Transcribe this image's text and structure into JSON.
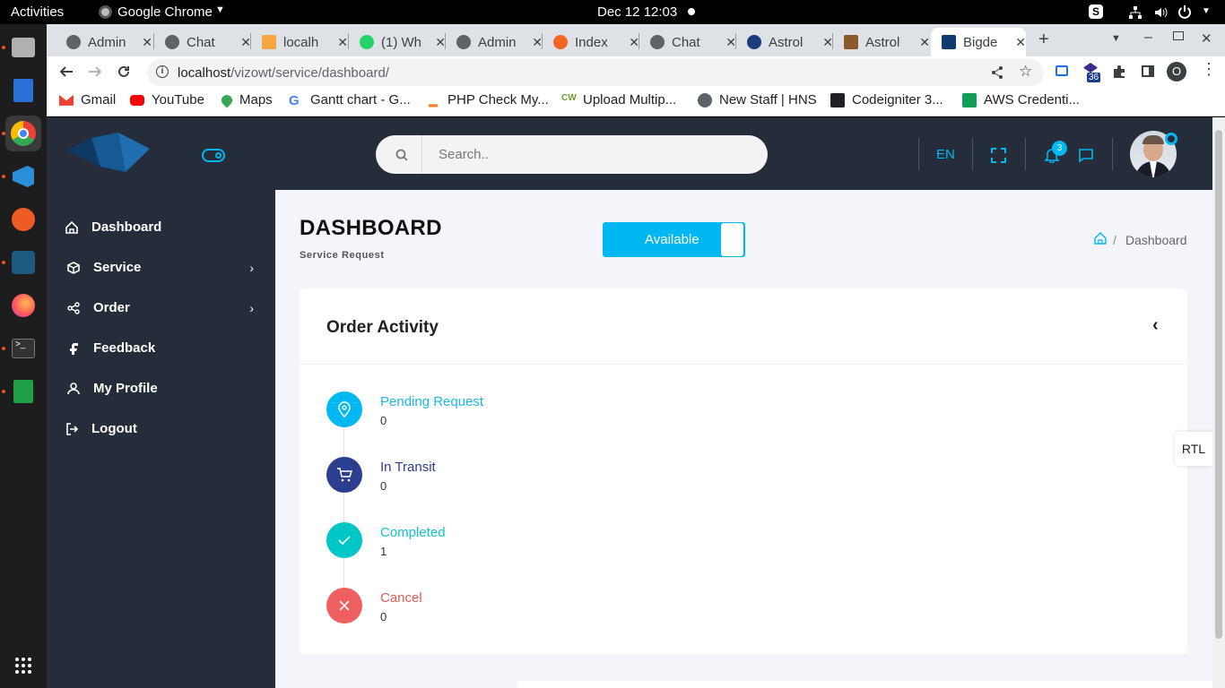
{
  "os": {
    "activities": "Activities",
    "app_name": "Google Chrome",
    "clock": "Dec 12  12:03"
  },
  "browser": {
    "tabs": [
      {
        "title": "Admin",
        "color": "#5f6368"
      },
      {
        "title": "Chat",
        "color": "#5f6368"
      },
      {
        "title": "localh",
        "color": "#f4a640"
      },
      {
        "title": "(1) Wh",
        "color": "#25d366"
      },
      {
        "title": "Admin",
        "color": "#5f6368"
      },
      {
        "title": "Index",
        "color": "#f26522"
      },
      {
        "title": "Chat",
        "color": "#5f6368"
      },
      {
        "title": "Astrol",
        "color": "#1a3d7c"
      },
      {
        "title": "Astrol",
        "color": "#8b5a2b"
      },
      {
        "title": "Bigde",
        "color": "#0f3b6e"
      }
    ],
    "url_host": "localhost",
    "url_path": "/vizowt/service/dashboard/",
    "extension_badge": "36",
    "profile_initial": "O",
    "bookmarks": [
      {
        "label": "Gmail",
        "color": "#ea4335"
      },
      {
        "label": "YouTube",
        "color": "#ff0000"
      },
      {
        "label": "Maps",
        "color": "#34a853"
      },
      {
        "label": "Gantt chart - G...",
        "color": "#4285f4"
      },
      {
        "label": "PHP Check My...",
        "color": "#f48024"
      },
      {
        "label": "Upload Multip...",
        "color": "#6d9e2a"
      },
      {
        "label": "New Staff | HNS",
        "color": "#5f6368"
      },
      {
        "label": "Codeigniter 3...",
        "color": "#202124"
      },
      {
        "label": "AWS Credenti...",
        "color": "#0f9d58"
      }
    ]
  },
  "app": {
    "search_placeholder": "Search..",
    "language": "EN",
    "notification_count": "3",
    "accent": "#00b8f1",
    "nav": [
      {
        "label": "Dashboard",
        "icon": "home-icon",
        "has_children": false
      },
      {
        "label": "Service",
        "icon": "box-icon",
        "has_children": true
      },
      {
        "label": "Order",
        "icon": "share-icon",
        "has_children": true
      },
      {
        "label": "Feedback",
        "icon": "feedback-icon",
        "has_children": false
      },
      {
        "label": "My Profile",
        "icon": "user-icon",
        "has_children": false
      },
      {
        "label": "Logout",
        "icon": "logout-icon",
        "has_children": false
      }
    ],
    "page_title": "DASHBOARD",
    "page_subtitle": "Service Request",
    "availability_label": "Available",
    "breadcrumb_current": "Dashboard",
    "breadcrumb_sep": "/",
    "card_title": "Order Activity",
    "activities": [
      {
        "label": "Pending Request",
        "value": "0",
        "color": "#00b8f1",
        "label_color": "#1ab7ea",
        "icon": "location-pin-icon"
      },
      {
        "label": "In Transit",
        "value": "0",
        "color": "#2c3e90",
        "label_color": "#2c3e90",
        "icon": "cart-icon"
      },
      {
        "label": "Completed",
        "value": "1",
        "color": "#00c7c7",
        "label_color": "#0fc3c9",
        "icon": "check-icon"
      },
      {
        "label": "Cancel",
        "value": "0",
        "color": "#ef6060",
        "label_color": "#e55a5a",
        "icon": "x-icon"
      }
    ],
    "rtl_label": "RTL"
  }
}
